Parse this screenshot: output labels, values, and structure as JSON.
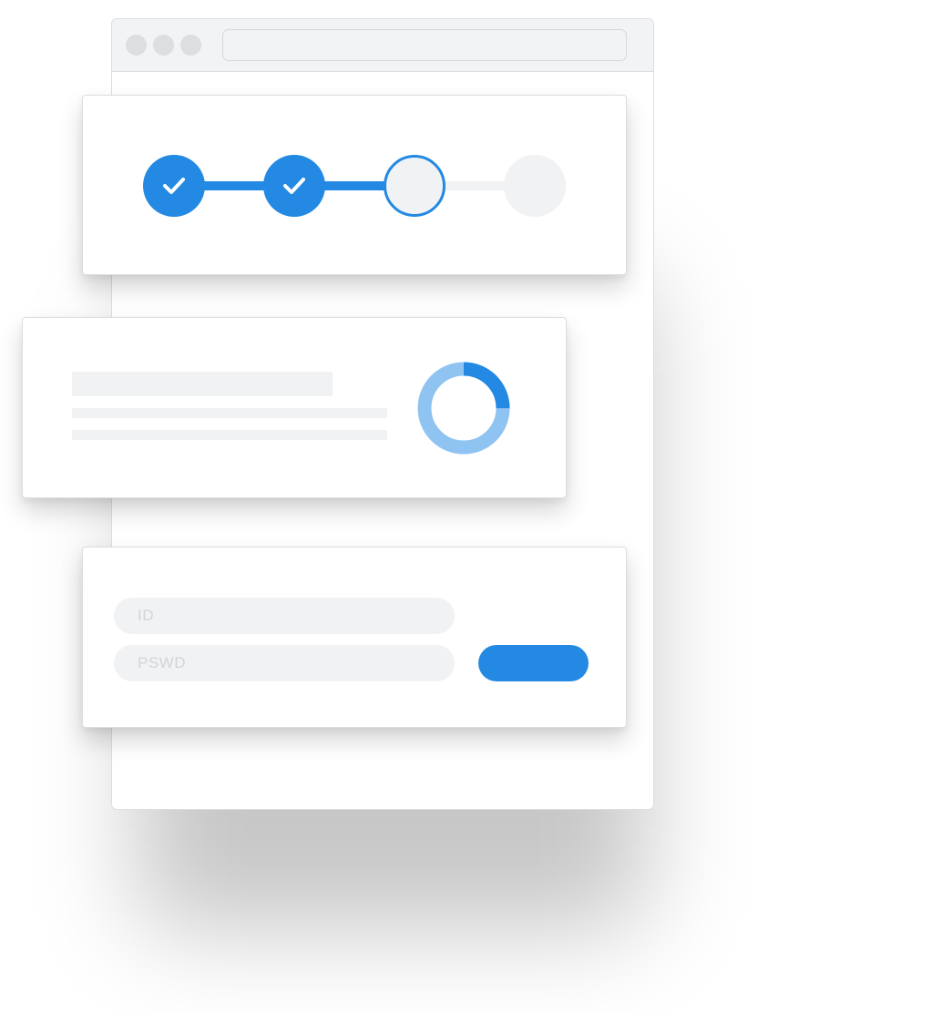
{
  "colors": {
    "accent": "#2389e2",
    "accent_light": "#8fc3f2",
    "skeleton": "#f1f2f4",
    "placeholder_text": "#d2d4d8"
  },
  "stepper": {
    "steps": [
      {
        "state": "completed",
        "icon": "check-icon"
      },
      {
        "state": "completed",
        "icon": "check-icon"
      },
      {
        "state": "current"
      },
      {
        "state": "pending"
      }
    ]
  },
  "progress": {
    "donut_fraction": 0.25
  },
  "login": {
    "id_placeholder": "ID",
    "password_placeholder": "PSWD",
    "submit_label": ""
  }
}
